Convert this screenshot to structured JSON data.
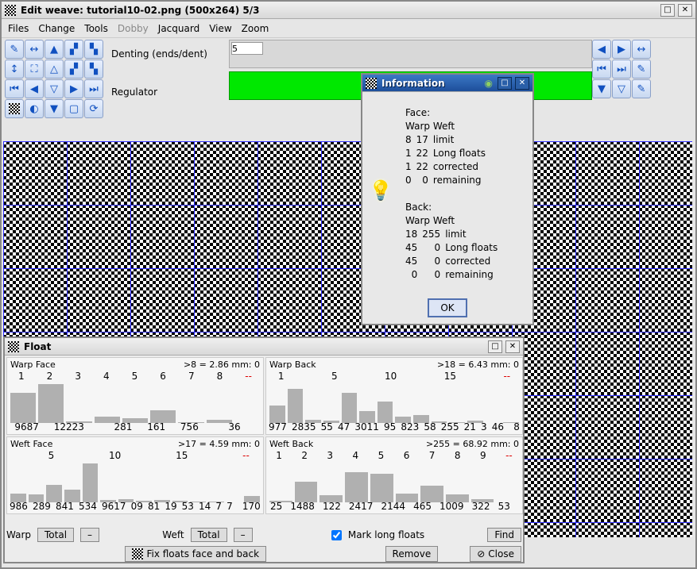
{
  "window": {
    "title": "Edit weave: tutorial10-02.png (500x264) 5/3"
  },
  "menu": [
    "Files",
    "Change",
    "Tools",
    "Dobby",
    "Jacquard",
    "View",
    "Zoom"
  ],
  "menu_disabled": [
    "Dobby"
  ],
  "labels": {
    "denting": "Denting (ends/dent)",
    "regulator": "Regulator"
  },
  "denting_value": "5",
  "info_dialog": {
    "title": "Information",
    "face_label": "Face:",
    "back_label": "Back:",
    "cols": "Warp Weft",
    "face": {
      "limit": {
        "warp": 8,
        "weft": 17,
        "name": "limit"
      },
      "long": {
        "warp": 1,
        "weft": 22,
        "name": "Long floats"
      },
      "corrected": {
        "warp": 1,
        "weft": 22,
        "name": "corrected"
      },
      "remaining": {
        "warp": 0,
        "weft": 0,
        "name": "remaining"
      }
    },
    "back": {
      "limit": {
        "warp": 18,
        "weft": 255,
        "name": "limit"
      },
      "long": {
        "warp": 45,
        "weft": 0,
        "name": "Long floats"
      },
      "corrected": {
        "warp": 45,
        "weft": 0,
        "name": "corrected"
      },
      "remaining": {
        "warp": 0,
        "weft": 0,
        "name": "remaining"
      }
    },
    "ok": "OK"
  },
  "float_win": {
    "title": "Float",
    "warp_face": {
      "header": "Warp  Face",
      "limit": ">8 = 2.86 mm: 0",
      "ticks": [
        "1",
        "2",
        "3",
        "4",
        "5",
        "6",
        "7",
        "8",
        "--"
      ],
      "bottoms": [
        "9687",
        "12223",
        "",
        "281",
        "161",
        "756",
        "",
        "36",
        ""
      ],
      "heights": [
        70,
        90,
        4,
        14,
        12,
        30,
        2,
        8,
        0
      ]
    },
    "warp_back": {
      "header": "Warp  Back",
      "limit": ">18 = 6.43 mm: 0",
      "ticks": [
        "1",
        "",
        "5",
        "",
        "10",
        "",
        "15",
        "",
        "--"
      ],
      "bottoms": [
        "977",
        "2835",
        "55",
        "47",
        "3011",
        "95",
        "823",
        "58",
        "255",
        "21",
        "3",
        "46",
        "",
        "8"
      ],
      "heights": [
        40,
        80,
        8,
        6,
        70,
        28,
        50,
        14,
        18,
        4,
        2,
        6,
        0,
        2
      ]
    },
    "weft_face": {
      "header": "Weft  Face",
      "limit": ">17 = 4.59 mm: 0",
      "ticks": [
        "",
        "5",
        "",
        "10",
        "",
        "15",
        "",
        "--"
      ],
      "bottoms": [
        "986",
        "289",
        "841",
        "534",
        "9617",
        "09",
        "81",
        "19",
        "53",
        "14",
        "7",
        "7",
        "",
        "170"
      ],
      "heights": [
        20,
        18,
        40,
        30,
        90,
        6,
        8,
        4,
        6,
        4,
        2,
        2,
        0,
        14
      ]
    },
    "weft_back": {
      "header": "Weft  Back",
      "limit": ">255 = 68.92 mm: 0",
      "ticks": [
        "1",
        "2",
        "3",
        "4",
        "5",
        "6",
        "7",
        "8",
        "9",
        "--"
      ],
      "bottoms": [
        "25",
        "1488",
        "122",
        "2417",
        "2144",
        "465",
        "1009",
        "322",
        "53",
        ""
      ],
      "heights": [
        4,
        48,
        16,
        70,
        66,
        20,
        38,
        18,
        8,
        0
      ]
    },
    "controls": {
      "warp": "Warp",
      "weft": "Weft",
      "total": "Total",
      "mark": "Mark long floats",
      "mark_checked": true,
      "find": "Find",
      "fix": "Fix floats face and back",
      "remove": "Remove",
      "close": "Close"
    }
  }
}
